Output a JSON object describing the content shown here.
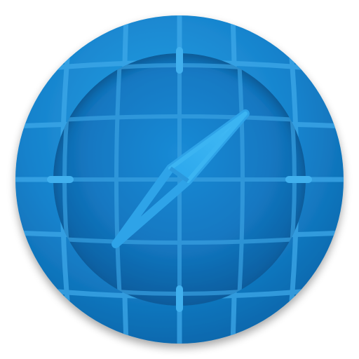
{
  "icon": {
    "name": "compass-icon",
    "colors": {
      "outer_ring_light": "#1c8fd6",
      "outer_ring_dark": "#0d6fb4",
      "dial_light": "#1a84cf",
      "dial_dark": "#0b5a9a",
      "grid_line": "#3aa7e8",
      "needle_light": "#38b2f1",
      "needle_dark": "#1d8fd6",
      "shadow": "#000000"
    }
  }
}
